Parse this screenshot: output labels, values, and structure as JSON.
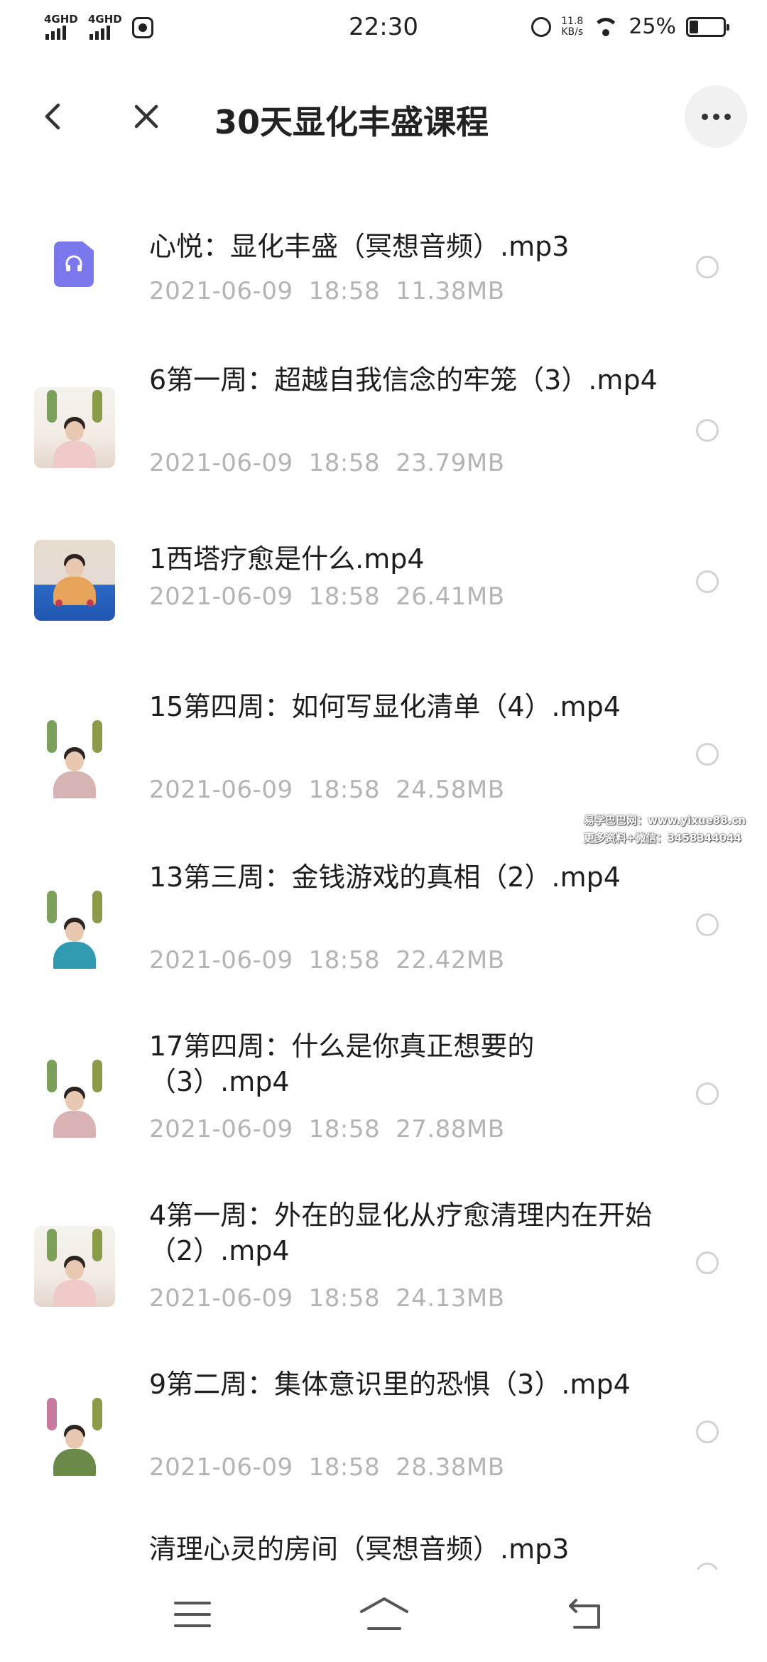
{
  "status_bar": {
    "network1": "4GHD",
    "network2": "4GHD",
    "time": "22:30",
    "speed_value": "11.8",
    "speed_unit": "KB/s",
    "battery_percent": "25%",
    "battery_level": 0.25
  },
  "header": {
    "title": "30天显化丰盛课程"
  },
  "files": [
    {
      "name": "心悦：显化丰盛（冥想音频）.mp3",
      "date": "2021-06-09",
      "time": "18:58",
      "size": "11.38MB",
      "type": "audio"
    },
    {
      "name": "6第一周：超越自我信念的牢笼（3）.mp4",
      "date": "2021-06-09",
      "time": "18:58",
      "size": "23.79MB",
      "type": "video"
    },
    {
      "name": "1西塔疗愈是什么.mp4",
      "date": "2021-06-09",
      "time": "18:58",
      "size": "26.41MB",
      "type": "video"
    },
    {
      "name": "15第四周：如何写显化清单（4）.mp4",
      "date": "2021-06-09",
      "time": "18:58",
      "size": "24.58MB",
      "type": "video"
    },
    {
      "name": "13第三周：金钱游戏的真相（2）.mp4",
      "date": "2021-06-09",
      "time": "18:58",
      "size": "22.42MB",
      "type": "video"
    },
    {
      "name": "17第四周：什么是你真正想要的（3）.mp4",
      "date": "2021-06-09",
      "time": "18:58",
      "size": "27.88MB",
      "type": "video"
    },
    {
      "name": "4第一周：外在的显化从疗愈清理内在开始（2）.mp4",
      "date": "2021-06-09",
      "time": "18:58",
      "size": "24.13MB",
      "type": "video"
    },
    {
      "name": "9第二周：集体意识里的恐惧（3）.mp4",
      "date": "2021-06-09",
      "time": "18:58",
      "size": "28.38MB",
      "type": "video"
    },
    {
      "name": "清理心灵的房间（冥想音频）.mp3",
      "type": "audio"
    }
  ],
  "watermark": {
    "line1": "易学巴巴网：www.yixue88.cn",
    "line2": "更多资料+微信：3458344044"
  },
  "icons": {
    "back": "back-arrow-icon",
    "close": "close-icon",
    "more": "more-options-icon",
    "audio": "headphones-icon",
    "nav_menu": "menu-icon",
    "nav_home": "home-icon",
    "nav_back": "return-icon"
  },
  "colors": {
    "audio_tile": "#7b78ee",
    "meta_text": "#b4b4b4",
    "radio_border": "#d3d3d3"
  }
}
